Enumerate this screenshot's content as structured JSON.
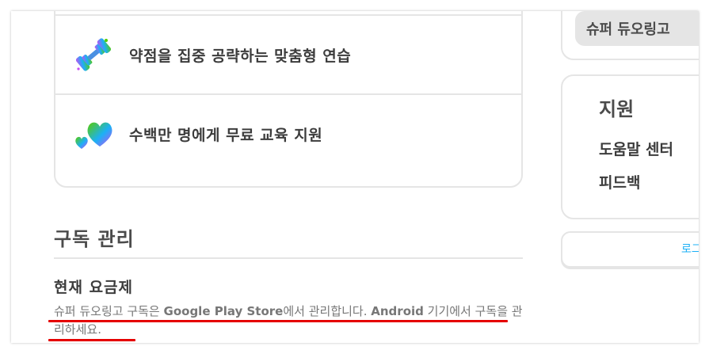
{
  "benefits": {
    "items": [
      {
        "label": "약점을 집중 공략하는 맞춤형 연습",
        "icon": "dumbbell-icon"
      },
      {
        "label": "수백만 명에게 무료 교육 지원",
        "icon": "hearts-icon"
      }
    ]
  },
  "subscription": {
    "section_title": "구독 관리",
    "plan_title": "현재 요금제",
    "desc_part1": "슈퍼 듀오링고 구독은 ",
    "desc_store": "Google Play Store",
    "desc_part2": "에서 관리합니다. ",
    "desc_android": "Android",
    "desc_part3": " 기기에서 구독을 관리하세요."
  },
  "sidebar": {
    "super_label": "슈퍼 듀오링고",
    "support_title": "지원",
    "help_center": "도움말 센터",
    "feedback": "피드백",
    "login_link": "로그"
  },
  "colors": {
    "border": "#e5e5e5",
    "text": "#4b4b4b",
    "link": "#1cb0f6",
    "annotation": "#e50000"
  }
}
